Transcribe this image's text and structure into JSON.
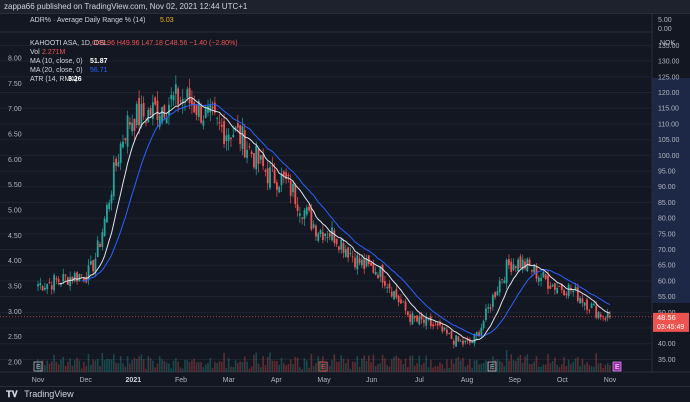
{
  "header": {
    "published": "zappa66 published on TradingView.com, Nov 02, 2021 12:44 UTC+1"
  },
  "indicator_pane": {
    "label": "ADR% · Average Daily Range % (14)",
    "value": "5.03",
    "ticks": [
      "5.00",
      "0.00"
    ]
  },
  "legend": {
    "symbol": "KAHOOTI ASA, 1D, OSL",
    "ohlc": "O49.96 H49.96 L47.18 C48.56 −1.40 (−2.80%)",
    "vol_label": "Vol",
    "vol_value": "2.271M",
    "ma10_label": "MA (10, close, 0)",
    "ma10_value": "51.87",
    "ma20_label": "MA (20, close, 0)",
    "ma20_value": "56.71",
    "atr_label": "ATR (14, RMA)",
    "atr_value": "3.26"
  },
  "price_badge": {
    "price": "48.56",
    "countdown": "03:45:49"
  },
  "axis_unit": "NOK",
  "footer": {
    "brand": "TradingView"
  },
  "markers": [
    "E",
    "E",
    "E",
    "E"
  ],
  "colors": {
    "up": "#26a69a",
    "down": "#ef5350",
    "ma10": "#e0e3eb",
    "ma20": "#2962ff",
    "bg": "#131722"
  },
  "chart_data": {
    "type": "candlestick",
    "title": "KAHOOTI ASA, 1D, OSL",
    "right_axis": {
      "ticks": [
        135,
        130,
        125,
        120,
        115,
        110,
        105,
        100,
        95,
        90,
        85,
        80,
        75,
        70,
        65,
        60,
        55,
        50,
        45,
        40,
        35
      ],
      "range": [
        31,
        138
      ]
    },
    "left_axis": {
      "ticks": [
        8.0,
        7.5,
        7.0,
        6.5,
        6.0,
        5.5,
        5.0,
        4.5,
        4.0,
        3.5,
        3.0,
        2.5,
        2.0
      ]
    },
    "x_tick_labels": [
      "Nov",
      "Dec",
      "2021",
      "Feb",
      "Mar",
      "Apr",
      "May",
      "Jun",
      "Jul",
      "Aug",
      "Sep",
      "Oct",
      "Nov"
    ],
    "x_tick_months_index": [
      0,
      1,
      2,
      3,
      4,
      5,
      6,
      7,
      8,
      9,
      10,
      11,
      12
    ],
    "monthly_close_nok": [
      {
        "month": "Nov 2020",
        "close": 59
      },
      {
        "month": "Dec 2020",
        "close": 62
      },
      {
        "month": "Jan 2021",
        "close": 112
      },
      {
        "month": "Feb 2021",
        "close": 118
      },
      {
        "month": "Mar 2021",
        "close": 108
      },
      {
        "month": "Apr 2021",
        "close": 93
      },
      {
        "month": "May 2021",
        "close": 76
      },
      {
        "month": "Jun 2021",
        "close": 64
      },
      {
        "month": "Jul 2021",
        "close": 47
      },
      {
        "month": "Aug 2021",
        "close": 40
      },
      {
        "month": "Sep 2021",
        "close": 66
      },
      {
        "month": "Oct 2021",
        "close": 58
      },
      {
        "month": "Nov 2021",
        "close": 48.56
      }
    ],
    "last_close": 48.56,
    "ma10": 51.87,
    "ma20": 56.71
  }
}
